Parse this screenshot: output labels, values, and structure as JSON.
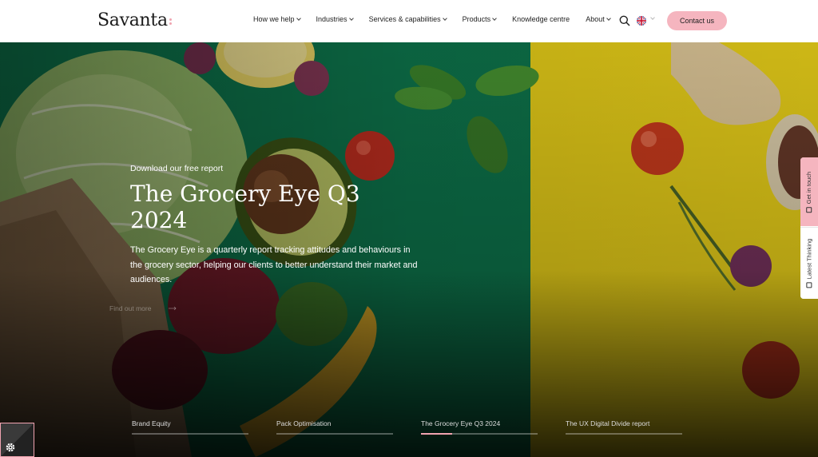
{
  "header": {
    "logo": "Savanta",
    "nav": [
      {
        "label": "How we help",
        "has_dropdown": true
      },
      {
        "label": "Industries",
        "has_dropdown": true
      },
      {
        "label": "Services & capabilities",
        "has_dropdown": true
      },
      {
        "label": "Products",
        "has_dropdown": true
      },
      {
        "label": "Knowledge centre",
        "has_dropdown": false
      },
      {
        "label": "About",
        "has_dropdown": true
      }
    ],
    "search_icon": "search-icon",
    "language_icon": "uk-flag-icon",
    "contact_label": "Contact us"
  },
  "hero": {
    "eyebrow": "Download our free report",
    "title": "The Grocery Eye Q3 2024",
    "description": "The Grocery Eye is a quarterly report tracking attitudes and behaviours in the grocery sector, helping our clients to better understand their market and audiences.",
    "cta_label": "Find out more"
  },
  "slides": [
    {
      "label": "Brand Equity",
      "progress": 0
    },
    {
      "label": "Pack Optimisation",
      "progress": 0
    },
    {
      "label": "The Grocery Eye Q3 2024",
      "progress": 0.27
    },
    {
      "label": "The UX Digital Divide report",
      "progress": 0
    }
  ],
  "side_tabs": {
    "get_in_touch": "Get in touch",
    "latest_thinking": "Latest Thinking"
  },
  "colors": {
    "accent_pink": "#f5b5bf",
    "hero_green": "#0e7a4f",
    "hero_yellow": "#f1d71a"
  }
}
